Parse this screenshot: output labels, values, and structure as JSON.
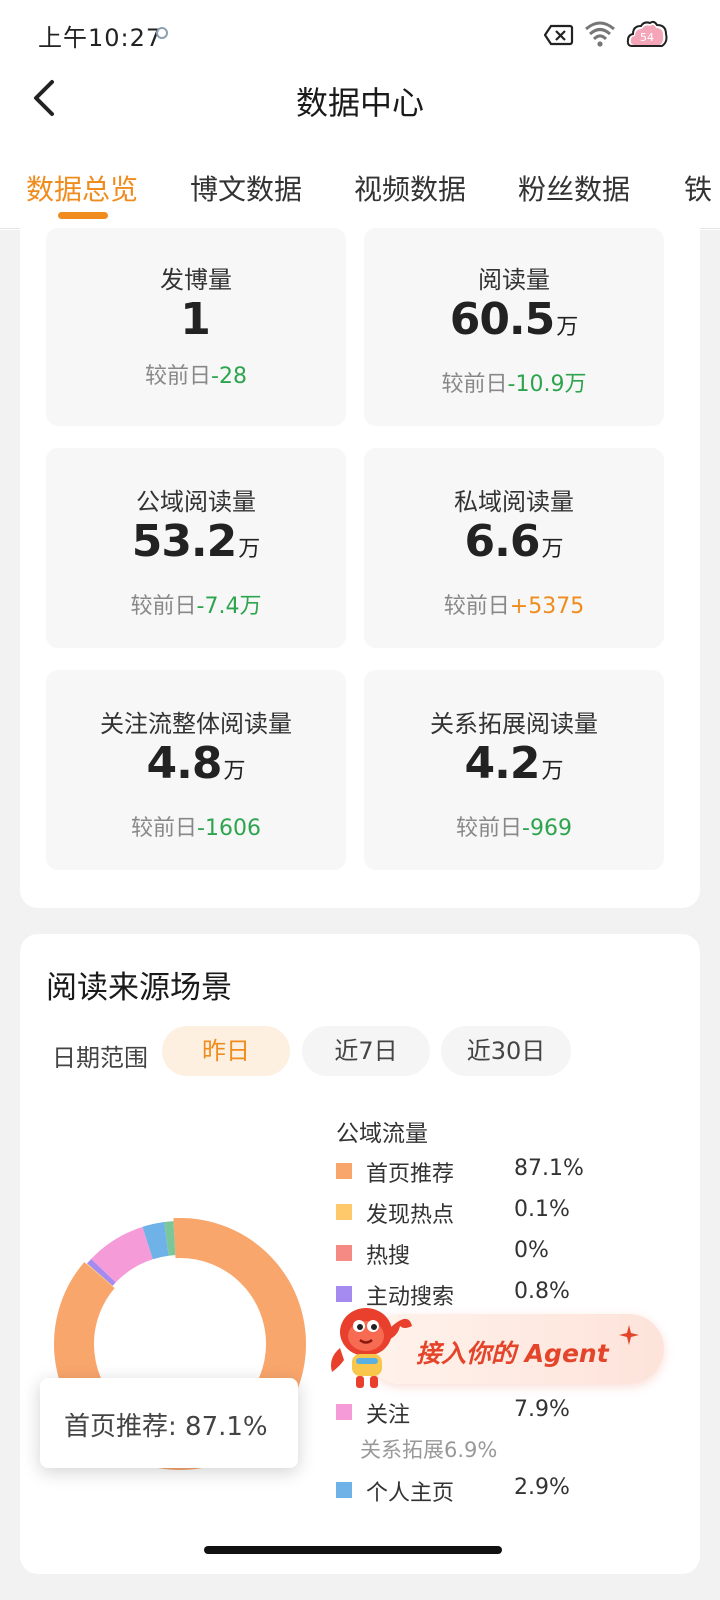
{
  "status_bar": {
    "time": "上午10:27",
    "battery": "54"
  },
  "nav": {
    "title": "数据中心"
  },
  "tabs": [
    "数据总览",
    "博文数据",
    "视频数据",
    "粉丝数据",
    "铁"
  ],
  "stats": [
    {
      "label": "发博量",
      "value": "1",
      "unit": "",
      "delta_prefix": "较前日",
      "delta": "-28",
      "trend": "down"
    },
    {
      "label": "阅读量",
      "value": "60.5",
      "unit": "万",
      "delta_prefix": "较前日",
      "delta": "-10.9万",
      "trend": "down"
    },
    {
      "label": "公域阅读量",
      "value": "53.2",
      "unit": "万",
      "delta_prefix": "较前日",
      "delta": "-7.4万",
      "trend": "down"
    },
    {
      "label": "私域阅读量",
      "value": "6.6",
      "unit": "万",
      "delta_prefix": "较前日",
      "delta": "+5375",
      "trend": "up"
    },
    {
      "label": "关注流整体阅读量",
      "value": "4.8",
      "unit": "万",
      "delta_prefix": "较前日",
      "delta": "-1606",
      "trend": "down"
    },
    {
      "label": "关系拓展阅读量",
      "value": "4.2",
      "unit": "万",
      "delta_prefix": "较前日",
      "delta": "-969",
      "trend": "down"
    }
  ],
  "source_section": {
    "title": "阅读来源场景",
    "range_label": "日期范围",
    "ranges": [
      "昨日",
      "近7日",
      "近30日"
    ],
    "active_range": 0,
    "legend_group": "公域流量",
    "legend": [
      {
        "label": "首页推荐",
        "pct": "87.1%",
        "color": "#f9a66c"
      },
      {
        "label": "发现热点",
        "pct": "0.1%",
        "color": "#fdc96a"
      },
      {
        "label": "热搜",
        "pct": "0%",
        "color": "#f58a85"
      },
      {
        "label": "主动搜索",
        "pct": "0.8%",
        "color": "#a58bf0"
      },
      {
        "label": "关注",
        "pct": "7.9%",
        "color": "#f49bd8"
      },
      {
        "label": "个人主页",
        "pct": "2.9%",
        "color": "#6eb2e8"
      }
    ],
    "sub_note": "关系拓展6.9%",
    "tooltip": "首页推荐: 87.1%",
    "donut": [
      {
        "label": "首页推荐",
        "value": 87.1,
        "color": "#f9a66c"
      },
      {
        "label": "发现热点",
        "value": 0.1,
        "color": "#fdc96a"
      },
      {
        "label": "热搜",
        "value": 0.0,
        "color": "#f58a85"
      },
      {
        "label": "主动搜索",
        "value": 0.8,
        "color": "#a58bf0"
      },
      {
        "label": "关注",
        "value": 7.9,
        "color": "#f49bd8"
      },
      {
        "label": "个人主页",
        "value": 2.9,
        "color": "#6eb2e8"
      },
      {
        "label": "其他",
        "value": 1.2,
        "color": "#7cc79a"
      }
    ]
  },
  "agent_banner": {
    "text": "接入你的 Agent"
  }
}
